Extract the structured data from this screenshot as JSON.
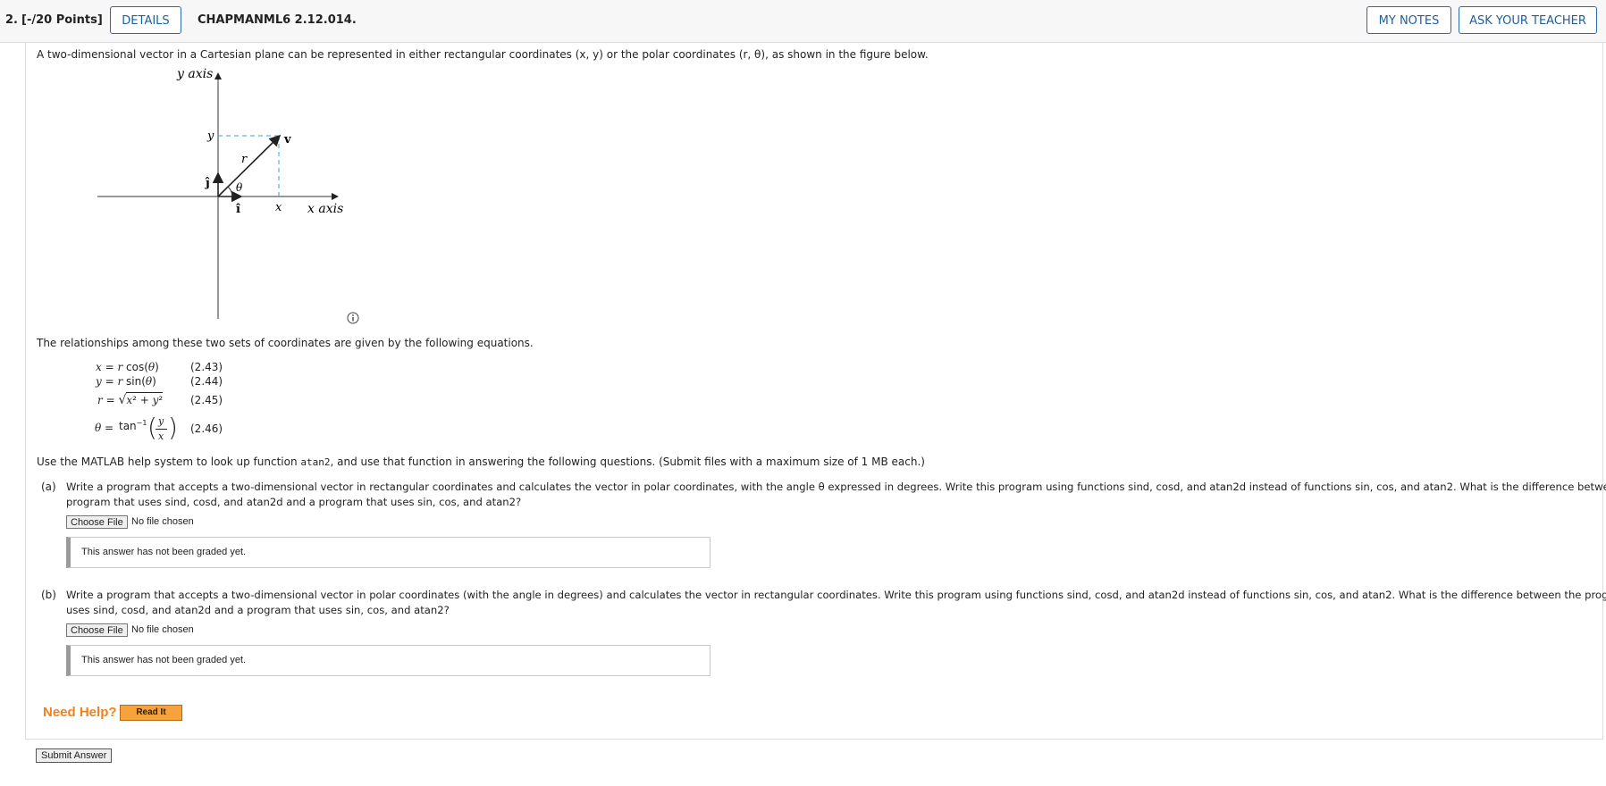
{
  "header": {
    "question_number": "2.",
    "points": "[-/20 Points]",
    "details_label": "DETAILS",
    "problem_code": "CHAPMANML6 2.12.014.",
    "my_notes_label": "MY NOTES",
    "ask_teacher_label": "ASK YOUR TEACHER"
  },
  "intro": "A two-dimensional vector in a Cartesian plane can be represented in either rectangular coordinates (x, y) or the polar coordinates (r, θ), as shown in the figure below.",
  "figure": {
    "y_axis_label": "y axis",
    "x_axis_label": "x axis",
    "y_label": "y",
    "x_label": "x",
    "r_label": "r",
    "theta_label": "θ",
    "v_label": "v",
    "j_hat": "ĵ",
    "i_hat": "î",
    "info_icon": "info-circle-icon"
  },
  "relationships_text": "The relationships among these two sets of coordinates are given by the following equations.",
  "equations": [
    {
      "lhs": "x",
      "rhs": "r cos(θ)",
      "number": "(2.43)"
    },
    {
      "lhs": "y",
      "rhs": "r sin(θ)",
      "number": "(2.44)"
    },
    {
      "lhs": "r",
      "rhs": "x² + y²",
      "number": "(2.45)"
    },
    {
      "lhs": "θ",
      "rhs": "tan⁻¹(y/x)",
      "number": "(2.46)"
    }
  ],
  "help_text": {
    "before": "Use the MATLAB help system to look up function ",
    "func": "atan2",
    "after": ", and use that function in answering the following questions. (Submit files with a maximum size of 1 MB each.)"
  },
  "parts": [
    {
      "label": "(a)",
      "line1": "Write a program that accepts a two-dimensional vector in rectangular coordinates and calculates the vector in polar coordinates, with the angle θ expressed in degrees. Write this program using functions sind, cosd, and atan2d instead of functions sin, cos, and atan2. What is the difference between the",
      "line2": "program that uses sind, cosd, and atan2d and a program that uses sin, cos, and atan2?",
      "choose_file": "Choose File",
      "no_file": "No file chosen",
      "graded": "This answer has not been graded yet."
    },
    {
      "label": "(b)",
      "line1": "Write a program that accepts a two-dimensional vector in polar coordinates (with the angle in degrees) and calculates the vector in rectangular coordinates. Write this program using functions sind, cosd, and atan2d instead of functions sin, cos, and atan2. What is the difference between the program that",
      "line2": "uses sind, cosd, and atan2d and a program that uses sin, cos, and atan2?",
      "choose_file": "Choose File",
      "no_file": "No file chosen",
      "graded": "This answer has not been graded yet."
    }
  ],
  "need_help": "Need Help?",
  "read_it": "Read It",
  "submit_label": "Submit Answer",
  "colors": {
    "accent_blue": "#1d5f9b",
    "need_help_orange": "#f0821e",
    "read_it_bg": "#f7a23b",
    "dashed_guides": "#3aa0d8"
  }
}
